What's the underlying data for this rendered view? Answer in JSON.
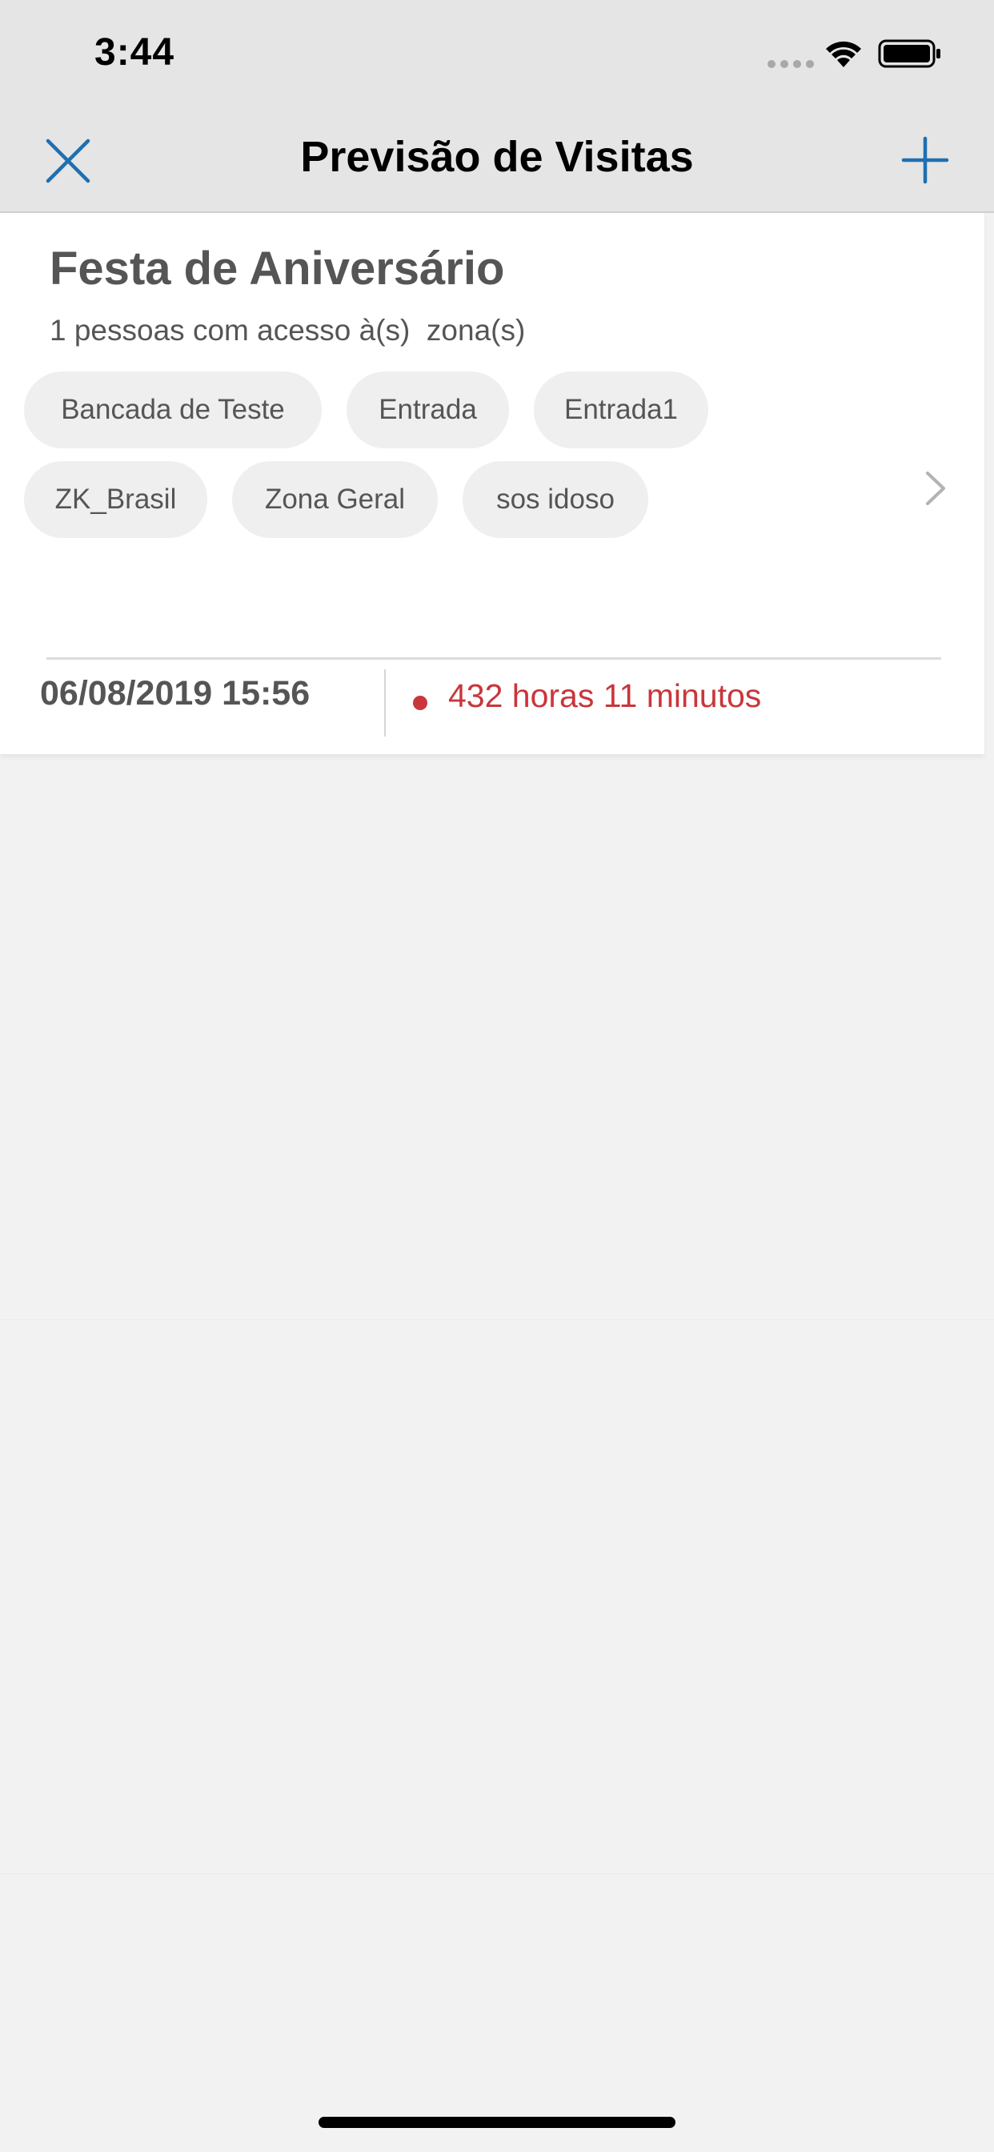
{
  "status_bar": {
    "time": "3:44",
    "icons": [
      "cellular-signal-icon",
      "wifi-icon",
      "battery-icon"
    ]
  },
  "nav": {
    "title": "Previsão de Visitas",
    "left_icon": "close-icon",
    "right_icon": "plus-icon"
  },
  "colors": {
    "accent": "#1f6fb0",
    "alert": "#c9363b",
    "chip_background": "#efefef",
    "background": "#f2f2f2",
    "bars": "#e5e5e5"
  },
  "visit": {
    "title": "Festa de Aniversário",
    "subtitle": "1 pessoas com acesso à(s)  zona(s)",
    "zones": [
      "Bancada de Teste",
      "Entrada",
      "Entrada1",
      "ZK_Brasil",
      "Zona Geral",
      "sos idoso"
    ],
    "date": "06/08/2019 15:56",
    "duration": "432 horas 11 minutos",
    "chevron_icon": "chevron-right-icon"
  }
}
